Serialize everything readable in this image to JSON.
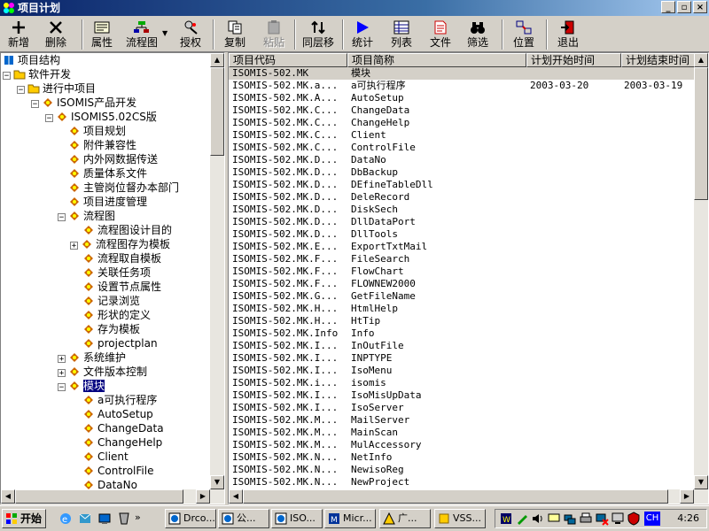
{
  "window": {
    "title": "项目计划"
  },
  "toolbar": {
    "items": [
      {
        "label": "新增",
        "icon": "plus-icon"
      },
      {
        "label": "删除",
        "icon": "x-icon"
      },
      {
        "label": "属性",
        "icon": "properties-icon"
      },
      {
        "label": "流程图",
        "icon": "flowchart-icon"
      },
      {
        "label": "授权",
        "icon": "authorize-icon"
      },
      {
        "label": "复制",
        "icon": "copy-icon"
      },
      {
        "label": "粘贴",
        "icon": "paste-icon"
      },
      {
        "label": "同层移",
        "icon": "move-icon"
      },
      {
        "label": "统计",
        "icon": "play-icon"
      },
      {
        "label": "列表",
        "icon": "list-icon"
      },
      {
        "label": "文件",
        "icon": "file-icon"
      },
      {
        "label": "筛选",
        "icon": "binoculars-icon"
      },
      {
        "label": "位置",
        "icon": "position-icon"
      },
      {
        "label": "退出",
        "icon": "exit-icon"
      }
    ]
  },
  "tree": {
    "items": [
      {
        "label": "项目结构"
      },
      {
        "label": "软件开发"
      },
      {
        "label": "进行中项目"
      },
      {
        "label": "ISOMIS产品开发"
      },
      {
        "label": "ISOMIS5.02CS版"
      },
      {
        "label": "项目规划"
      },
      {
        "label": "附件兼容性"
      },
      {
        "label": "内外网数据传送"
      },
      {
        "label": "质量体系文件"
      },
      {
        "label": "主管岗位督办本部门"
      },
      {
        "label": "项目进度管理"
      },
      {
        "label": "流程图"
      },
      {
        "label": "流程图设计目的"
      },
      {
        "label": "流程图存为模板"
      },
      {
        "label": "流程取自模板"
      },
      {
        "label": "关联任务项"
      },
      {
        "label": "设置节点属性"
      },
      {
        "label": "记录浏览"
      },
      {
        "label": "形状的定义"
      },
      {
        "label": "存为模板"
      },
      {
        "label": "projectplan"
      },
      {
        "label": "系统维护"
      },
      {
        "label": "文件版本控制"
      },
      {
        "label": "模块"
      },
      {
        "label": "a可执行程序"
      },
      {
        "label": "AutoSetup"
      },
      {
        "label": "ChangeData"
      },
      {
        "label": "ChangeHelp"
      },
      {
        "label": "Client"
      },
      {
        "label": "ControlFile"
      },
      {
        "label": "DataNo"
      }
    ]
  },
  "list": {
    "columns": [
      "项目代码",
      "项目简称",
      "计划开始时间",
      "计划结束时间"
    ],
    "rows": [
      {
        "code": "ISOMIS-502.MK",
        "name": "模块",
        "start": "",
        "end": ""
      },
      {
        "code": "ISOMIS-502.MK.a...",
        "name": "a可执行程序",
        "start": "2003-03-20",
        "end": "2003-03-19"
      },
      {
        "code": "ISOMIS-502.MK.A...",
        "name": "AutoSetup",
        "start": "",
        "end": ""
      },
      {
        "code": "ISOMIS-502.MK.C...",
        "name": "ChangeData",
        "start": "",
        "end": ""
      },
      {
        "code": "ISOMIS-502.MK.C...",
        "name": "ChangeHelp",
        "start": "",
        "end": ""
      },
      {
        "code": "ISOMIS-502.MK.C...",
        "name": "Client",
        "start": "",
        "end": ""
      },
      {
        "code": "ISOMIS-502.MK.C...",
        "name": "ControlFile",
        "start": "",
        "end": ""
      },
      {
        "code": "ISOMIS-502.MK.D...",
        "name": "DataNo",
        "start": "",
        "end": ""
      },
      {
        "code": "ISOMIS-502.MK.D...",
        "name": "DbBackup",
        "start": "",
        "end": ""
      },
      {
        "code": "ISOMIS-502.MK.D...",
        "name": "DEfineTableDll",
        "start": "",
        "end": ""
      },
      {
        "code": "ISOMIS-502.MK.D...",
        "name": "DeleRecord",
        "start": "",
        "end": ""
      },
      {
        "code": "ISOMIS-502.MK.D...",
        "name": "DiskSech",
        "start": "",
        "end": ""
      },
      {
        "code": "ISOMIS-502.MK.D...",
        "name": "DllDataPort",
        "start": "",
        "end": ""
      },
      {
        "code": "ISOMIS-502.MK.D...",
        "name": "DllTools",
        "start": "",
        "end": ""
      },
      {
        "code": "ISOMIS-502.MK.E...",
        "name": "ExportTxtMail",
        "start": "",
        "end": ""
      },
      {
        "code": "ISOMIS-502.MK.F...",
        "name": "FileSearch",
        "start": "",
        "end": ""
      },
      {
        "code": "ISOMIS-502.MK.F...",
        "name": "FlowChart",
        "start": "",
        "end": ""
      },
      {
        "code": "ISOMIS-502.MK.F...",
        "name": "FLOWNEW2000",
        "start": "",
        "end": ""
      },
      {
        "code": "ISOMIS-502.MK.G...",
        "name": "GetFileName",
        "start": "",
        "end": ""
      },
      {
        "code": "ISOMIS-502.MK.H...",
        "name": "HtmlHelp",
        "start": "",
        "end": ""
      },
      {
        "code": "ISOMIS-502.MK.H...",
        "name": "HtTip",
        "start": "",
        "end": ""
      },
      {
        "code": "ISOMIS-502.MK.Info",
        "name": "Info",
        "start": "",
        "end": ""
      },
      {
        "code": "ISOMIS-502.MK.I...",
        "name": "InOutFile",
        "start": "",
        "end": ""
      },
      {
        "code": "ISOMIS-502.MK.I...",
        "name": "INPTYPE",
        "start": "",
        "end": ""
      },
      {
        "code": "ISOMIS-502.MK.I...",
        "name": "IsoMenu",
        "start": "",
        "end": ""
      },
      {
        "code": "ISOMIS-502.MK.i...",
        "name": "isomis",
        "start": "",
        "end": ""
      },
      {
        "code": "ISOMIS-502.MK.I...",
        "name": "IsoMisUpData",
        "start": "",
        "end": ""
      },
      {
        "code": "ISOMIS-502.MK.I...",
        "name": "IsoServer",
        "start": "",
        "end": ""
      },
      {
        "code": "ISOMIS-502.MK.M...",
        "name": "MailServer",
        "start": "",
        "end": ""
      },
      {
        "code": "ISOMIS-502.MK.M...",
        "name": "MainScan",
        "start": "",
        "end": ""
      },
      {
        "code": "ISOMIS-502.MK.M...",
        "name": "MulAccessory",
        "start": "",
        "end": ""
      },
      {
        "code": "ISOMIS-502.MK.N...",
        "name": "NetInfo",
        "start": "",
        "end": ""
      },
      {
        "code": "ISOMIS-502.MK.N...",
        "name": "NewisoReg",
        "start": "",
        "end": ""
      },
      {
        "code": "ISOMIS-502.MK.N...",
        "name": "NewProject",
        "start": "",
        "end": ""
      }
    ]
  },
  "taskbar": {
    "start_label": "开始",
    "tasks": [
      {
        "label": "Drco..."
      },
      {
        "label": "公..."
      },
      {
        "label": "ISO..."
      },
      {
        "label": "Micr..."
      },
      {
        "label": "广..."
      },
      {
        "label": "VSS..."
      }
    ],
    "tray": {
      "ime": "CH",
      "clock": "4:26"
    }
  },
  "colors": {
    "selection": "#000080",
    "face": "#d4d0c8",
    "title_start": "#0a246a",
    "title_end": "#a6caf0"
  }
}
